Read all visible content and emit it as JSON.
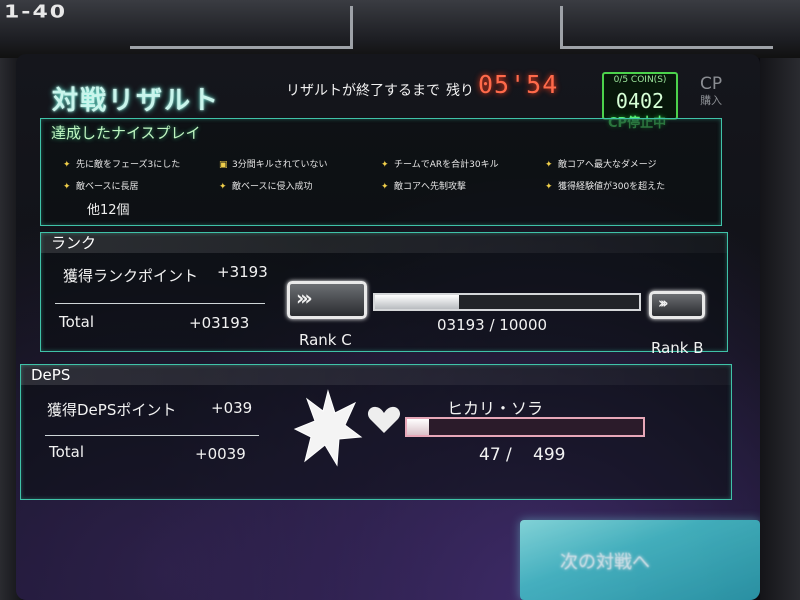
{
  "cabinet": {
    "label": "1-40"
  },
  "header": {
    "title": "対戦リザルト",
    "timer_label": "リザルトが終了するまで",
    "timer_suffix": "残り",
    "timer_value": "05'54"
  },
  "coin": {
    "label": "0/5 COIN(S)",
    "value": "0402"
  },
  "cp": {
    "title": "CP",
    "buy": "購入",
    "status": "CP停止中"
  },
  "plays": {
    "heading": "達成したナイスプレイ",
    "items": [
      "先に敵をフェーズ3にした",
      "3分間キルされていない",
      "チームでARを合計30キル",
      "敵コアへ最大なダメージ",
      "敵ベースに長居",
      "敵ベースに侵入成功",
      "敵コアへ先制攻撃",
      "獲得経験値が300を超えた"
    ],
    "others": "他12個"
  },
  "rank": {
    "heading": "ランク",
    "points_label": "獲得ランクポイント",
    "points_value": "+3193",
    "total_label": "Total",
    "total_value": "+03193",
    "progress_text": "03193 / 10000",
    "progress_fraction": 0.3193,
    "current_rank": "Rank C",
    "next_rank": "Rank B"
  },
  "deps": {
    "heading": "DePS",
    "points_label": "獲得DePSポイント",
    "points_value": "+039",
    "total_label": "Total",
    "total_value": "+0039",
    "character": "ヒカリ・ソラ",
    "progress_current": "47 /",
    "progress_max": "499",
    "progress_fraction": 0.094
  },
  "next_button": {
    "label": "次の対戦へ"
  },
  "colors": {
    "accent": "#3fc2a8",
    "title_glow": "#4fd9c4",
    "timer": "#ff6a4a",
    "coin_green": "#4cd24c",
    "deps_bar": "#e7a7b8"
  },
  "icons": [
    "medal-icon",
    "star-burst-icon",
    "heart-icon",
    "chevron-right-icon"
  ]
}
